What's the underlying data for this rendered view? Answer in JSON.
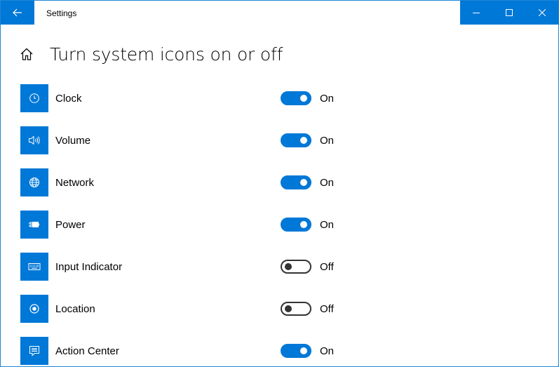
{
  "window": {
    "app_title": "Settings",
    "accent": "#0078d7"
  },
  "header": {
    "page_title": "Turn system icons on or off",
    "icon": "home-icon"
  },
  "items": [
    {
      "label": "Clock",
      "state_label": "On",
      "on": true,
      "icon": "clock-icon"
    },
    {
      "label": "Volume",
      "state_label": "On",
      "on": true,
      "icon": "volume-icon"
    },
    {
      "label": "Network",
      "state_label": "On",
      "on": true,
      "icon": "network-icon"
    },
    {
      "label": "Power",
      "state_label": "On",
      "on": true,
      "icon": "power-icon"
    },
    {
      "label": "Input Indicator",
      "state_label": "Off",
      "on": false,
      "icon": "keyboard-icon"
    },
    {
      "label": "Location",
      "state_label": "Off",
      "on": false,
      "icon": "location-icon"
    },
    {
      "label": "Action Center",
      "state_label": "On",
      "on": true,
      "icon": "action-center-icon"
    }
  ]
}
